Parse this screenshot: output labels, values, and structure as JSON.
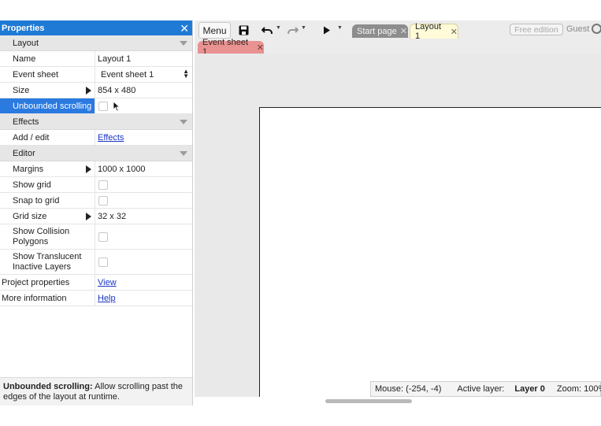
{
  "properties": {
    "title": "Properties",
    "close": "✕",
    "layout_section": "Layout",
    "name_label": "Name",
    "name_value": "Layout 1",
    "event_sheet_label": "Event sheet",
    "event_sheet_value": "Event sheet 1",
    "size_label": "Size",
    "size_value": "854 x 480",
    "unbounded_label": "Unbounded scrolling",
    "effects_section": "Effects",
    "add_edit_label": "Add / edit",
    "add_edit_link": "Effects",
    "editor_section": "Editor",
    "margins_label": "Margins",
    "margins_value": "1000 x 1000",
    "show_grid_label": "Show grid",
    "snap_label": "Snap to grid",
    "grid_size_label": "Grid size",
    "grid_size_value": "32 x 32",
    "collision_label": "Show Collision Polygons",
    "translucent_label": "Show Translucent Inactive Layers",
    "project_label": "Project properties",
    "project_link": "View",
    "more_label": "More information",
    "more_link": "Help"
  },
  "help": {
    "term": "Unbounded scrolling:",
    "text": " Allow scrolling past the edges of the layout at runtime."
  },
  "toolbar": {
    "menu_label": "Menu",
    "tab_start": "Start page",
    "tab_layout": "Layout 1",
    "tab_close": "✕",
    "free_edition": "Free edition",
    "guest": "Guest"
  },
  "tabs2": {
    "event_sheet": "Event sheet 1"
  },
  "status": {
    "mouse": "Mouse: (-254, -4)",
    "active_layer_label": "Active layer:",
    "active_layer_value": "Layer 0",
    "zoom": "Zoom: 100%"
  },
  "colors": {
    "header_blue": "#1f7ad6",
    "selection_blue": "#2a7ae0",
    "layout_tab": "#fffbd8",
    "event_tab": "#e89292",
    "start_tab": "#8d8d8d"
  },
  "icons": [
    "close-icon",
    "save-icon",
    "undo-icon",
    "redo-icon",
    "play-icon",
    "user-icon",
    "expand-arrow-icon",
    "select-arrows-icon",
    "mouse-cursor-icon"
  ]
}
